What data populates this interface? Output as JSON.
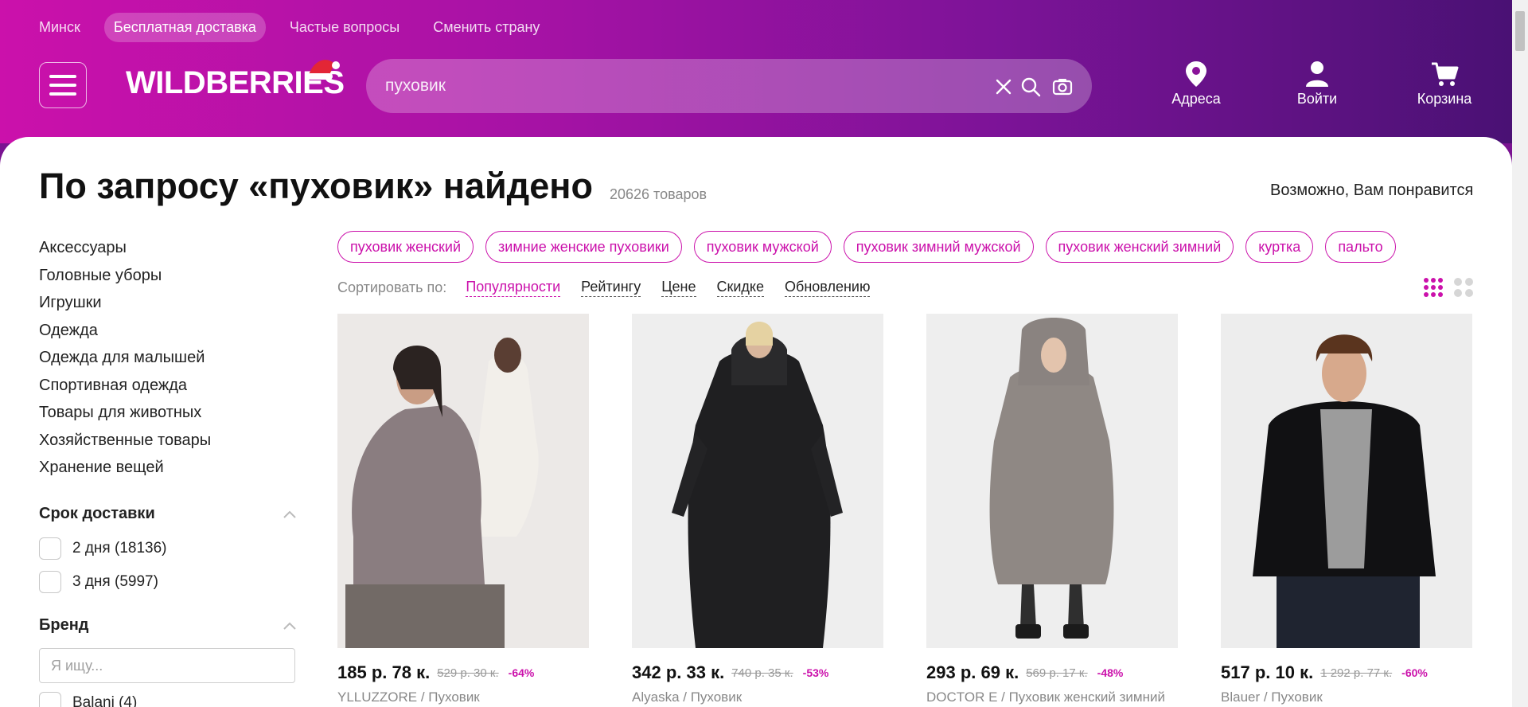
{
  "header": {
    "top_links": [
      "Минск",
      "Бесплатная доставка",
      "Частые вопросы",
      "Сменить страну"
    ],
    "logo": "WILDBERRIES",
    "search": {
      "value": "пуховик"
    },
    "actions": [
      {
        "label": "Адреса",
        "icon": "location-pin-icon"
      },
      {
        "label": "Войти",
        "icon": "user-icon"
      },
      {
        "label": "Корзина",
        "icon": "cart-icon"
      }
    ]
  },
  "results": {
    "title": "По запросу «пуховик» найдено",
    "count": "20626 товаров",
    "recommend": "Возможно, Вам понравится"
  },
  "sidebar": {
    "categories": [
      "Аксессуары",
      "Головные уборы",
      "Игрушки",
      "Одежда",
      "Одежда для малышей",
      "Спортивная одежда",
      "Товары для животных",
      "Хозяйственные товары",
      "Хранение вещей"
    ],
    "delivery": {
      "title": "Срок доставки",
      "options": [
        "2 дня (18136)",
        "3 дня (5997)"
      ]
    },
    "brand": {
      "title": "Бренд",
      "placeholder": "Я ищу...",
      "first_option": "Balani  (4)"
    }
  },
  "chips": [
    "пуховик женский",
    "зимние женские пуховики",
    "пуховик мужской",
    "пуховик зимний мужской",
    "пуховик женский зимний",
    "куртка",
    "пальто"
  ],
  "sort": {
    "label": "Сортировать по:",
    "options": [
      "Популярности",
      "Рейтингу",
      "Цене",
      "Скидке",
      "Обновлению"
    ],
    "active": "Популярности"
  },
  "products": [
    {
      "price": "185 р. 78 к.",
      "old_price": "529 р. 30 к.",
      "discount": "-64%",
      "brand": "YLLUZZORE / Пуховик"
    },
    {
      "price": "342 р. 33 к.",
      "old_price": "740 р. 35 к.",
      "discount": "-53%",
      "brand": "Alyaska / Пуховик"
    },
    {
      "price": "293 р. 69 к.",
      "old_price": "569 р. 17 к.",
      "discount": "-48%",
      "brand": "DOCTOR E / Пуховик женский зимний"
    },
    {
      "price": "517 р. 10 к.",
      "old_price": "1 292 р. 77 к.",
      "discount": "-60%",
      "brand": "Blauer / Пуховик"
    }
  ],
  "colors": {
    "accent": "#cb11ab",
    "header_start": "#cb11ab",
    "header_end": "#481173"
  }
}
